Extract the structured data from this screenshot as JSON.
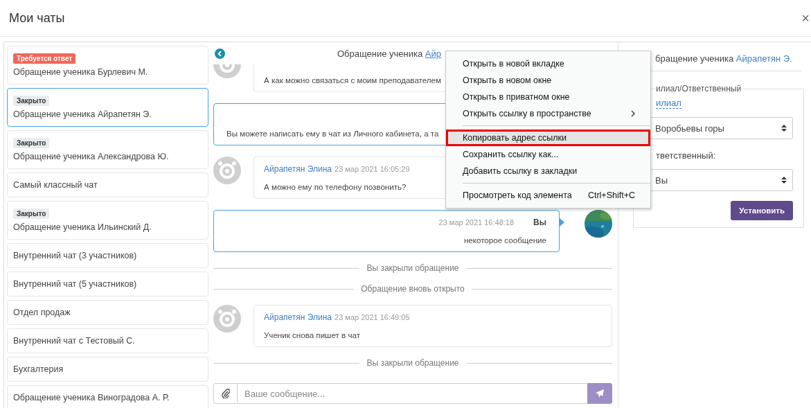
{
  "header": {
    "title": "Мои чаты",
    "close": "×"
  },
  "chat_list": [
    {
      "badge": {
        "kind": "alert",
        "text": "Требуется ответ"
      },
      "title": "Обращение ученика Бурлевич М.",
      "selected": false
    },
    {
      "badge": {
        "kind": "closed",
        "text": "Закрыто"
      },
      "title": "Обращение ученика Айрапетян Э.",
      "selected": true
    },
    {
      "badge": {
        "kind": "closed",
        "text": "Закрыто"
      },
      "title": "Обращение ученика Александрова Ю.",
      "selected": false
    },
    {
      "title": "Самый классный чат",
      "selected": false
    },
    {
      "badge": {
        "kind": "closed",
        "text": "Закрыто"
      },
      "title": "Обращение ученика Ильинский Д.",
      "selected": false
    },
    {
      "title": "Внутренний чат (3 участников)",
      "selected": false
    },
    {
      "title": "Внутренний чат (5 участников)",
      "selected": false
    },
    {
      "title": "Отдел продаж",
      "selected": false
    },
    {
      "title": "Внутренний чат с Тестовый С.",
      "selected": false
    },
    {
      "title": "Бухгалтерия",
      "selected": false
    },
    {
      "title": "Обращение ученика Виноградова А. Р.",
      "selected": false
    }
  ],
  "conversation": {
    "title": "Обращение ученика",
    "title_link": "Айр",
    "messages": [
      {
        "kind": "incoming",
        "text": "А как можно связаться с моим преподавателем"
      },
      {
        "kind": "outgoing",
        "text": "Вы можете написать ему в чат из Личного кабинета, а та",
        "show_avatar": false
      },
      {
        "kind": "incoming",
        "author": "Айрапетян Элина",
        "time": "23 мар 2021 16:05:29",
        "text": "А можно ему по телефону позвонить?"
      },
      {
        "kind": "outgoing",
        "time": "23 мар 2021 16:48:18",
        "author": "Вы",
        "text": "некоторое сообщение",
        "show_avatar": true
      },
      {
        "kind": "event",
        "text": "Вы закрыли обращение"
      },
      {
        "kind": "event",
        "text": "Обращение вновь открыто"
      },
      {
        "kind": "incoming",
        "author": "Айрапетян Элина",
        "time": "23 мар 2021 16:49:05",
        "text": "Ученик снова пишет в чат"
      },
      {
        "kind": "event",
        "text": "Вы закрыли обращение"
      }
    ],
    "composer": {
      "placeholder": "Ваше сообщение..."
    }
  },
  "details": {
    "title": "бращение ученика",
    "title_link": "Айрапетян Э.",
    "legend": "илиал/Ответственный",
    "branch_link": "илиал",
    "branch_value": "Воробьевы горы",
    "responsible_label": "тветственный:",
    "responsible_value": "Вы",
    "submit": "Установить"
  },
  "context_menu": {
    "items": [
      {
        "kind": "item",
        "label": "Открыть в новой вкладке",
        "highlighted": false
      },
      {
        "kind": "item",
        "label": "Открыть в новом окне",
        "highlighted": false
      },
      {
        "kind": "item",
        "label": "Открыть в приватном окне",
        "highlighted": false
      },
      {
        "kind": "item",
        "label": "Открыть ссылку в пространстве",
        "highlighted": false,
        "submenu": true
      },
      {
        "kind": "separator"
      },
      {
        "kind": "item",
        "label": "Копировать адрес ссылки",
        "highlighted": true
      },
      {
        "kind": "item",
        "label": "Сохранить ссылку как...",
        "highlighted": false
      },
      {
        "kind": "item",
        "label": "Добавить ссылку в закладки",
        "highlighted": false
      },
      {
        "kind": "separator"
      },
      {
        "kind": "item",
        "label": "Просмотреть код элемента",
        "highlighted": false,
        "shortcut": "Ctrl+Shift+C"
      }
    ]
  }
}
